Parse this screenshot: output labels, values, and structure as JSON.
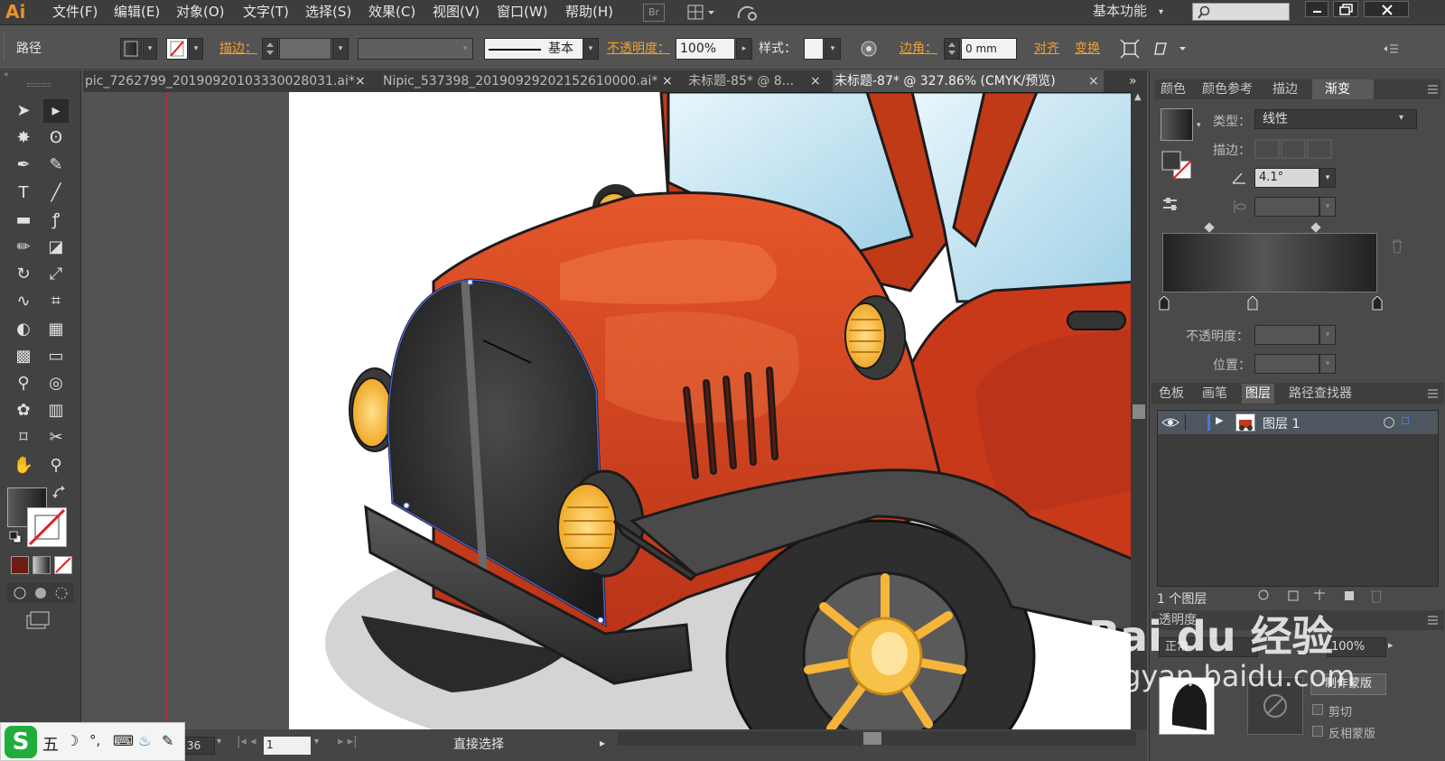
{
  "app": {
    "logo": "Ai"
  },
  "menus": [
    "文件(F)",
    "编辑(E)",
    "对象(O)",
    "文字(T)",
    "选择(S)",
    "效果(C)",
    "视图(V)",
    "窗口(W)",
    "帮助(H)"
  ],
  "menubar_right": {
    "br": "Br",
    "workspace": "基本功能",
    "workspace_caret": "▾"
  },
  "control": {
    "selection_type": "路径",
    "stroke_label": "描边：",
    "style_preset": "基本",
    "opacity_label": "不透明度：",
    "opacity_value": "100%",
    "style_label": "样式：",
    "corner_label": "边角：",
    "corner_value": "0 mm",
    "align_label": "对齐",
    "transform_label": "变换"
  },
  "tabs": [
    "pic_7262799_20190920103330028031.ai*",
    "Nipic_537398_20190929202152610000.ai*",
    "未标题-85* @ 8...",
    "未标题-87* @ 327.86% (CMYK/预览)"
  ],
  "tab_close": "×",
  "tab_overflow": "»",
  "status": {
    "zoom": "36",
    "page": "1",
    "tool": "直接选择"
  },
  "panel_top": {
    "tabs": [
      "颜色",
      "颜色参考",
      "描边",
      "渐变"
    ],
    "active": 3,
    "type_label": "类型：",
    "type_value": "线性",
    "stroke_label": "描边：",
    "angle_value": "4.1°",
    "opacity_label": "不透明度：",
    "position_label": "位置："
  },
  "panel_mid": {
    "tabs": [
      "色板",
      "画笔",
      "图层",
      "路径查找器"
    ],
    "active": 2,
    "layer_name": "图层 1",
    "layer_count": "1 个图层"
  },
  "panel_bot": {
    "title": "透明度",
    "mode": "正常",
    "opacity_value": "100%",
    "make_mask": "制作蒙版",
    "clip": "剪切",
    "invert": "反相蒙版"
  },
  "ime": {
    "chars": [
      "五",
      "☽",
      "°,",
      "⌨",
      "♨",
      "✎"
    ]
  },
  "watermark": {
    "line1": "Bai du 经验",
    "line2": "jingyan.baidu.com"
  },
  "colors": {
    "accent": "#f0a030",
    "car_body": "#d9431c",
    "canvas": "#ffffff"
  },
  "icons": [
    "selection-icon",
    "direct-selection-icon",
    "magic-wand-icon",
    "lasso-icon",
    "pen-icon",
    "curvature-icon",
    "type-icon",
    "line-icon",
    "rectangle-icon",
    "paintbrush-icon",
    "pencil-icon",
    "eraser-icon",
    "rotate-icon",
    "scale-icon",
    "warp-icon",
    "free-transform-icon",
    "shape-builder-icon",
    "perspective-icon",
    "mesh-icon",
    "gradient-icon",
    "eyedropper-icon",
    "blend-icon",
    "symbol-sprayer-icon",
    "graph-icon",
    "artboard-icon",
    "slice-icon",
    "hand-icon",
    "zoom-icon"
  ]
}
